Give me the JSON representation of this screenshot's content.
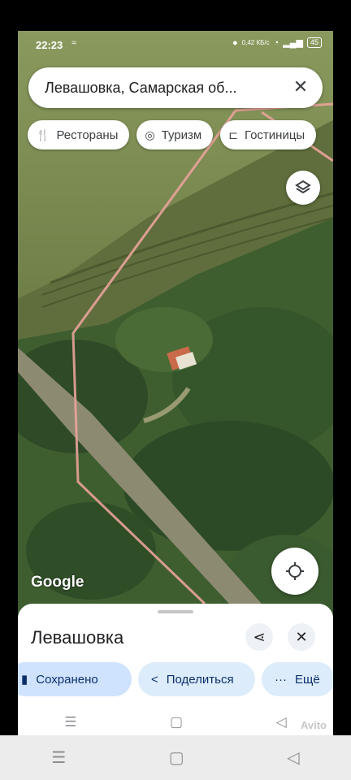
{
  "status_bar": {
    "time": "22:23",
    "network_speed": "0,42 КБ/с",
    "battery": "45"
  },
  "search": {
    "query": "Левашовка, Самарская об...",
    "close_icon": "close-icon"
  },
  "chips": [
    {
      "label": "Рестораны",
      "icon": "restaurant-icon"
    },
    {
      "label": "Туризм",
      "icon": "camera-icon"
    },
    {
      "label": "Гостиницы",
      "icon": "bed-icon"
    }
  ],
  "map": {
    "attribution": "Google"
  },
  "place_sheet": {
    "title": "Левашовка",
    "actions": [
      {
        "label": "Сохранено",
        "icon": "bookmark-icon"
      },
      {
        "label": "Поделиться",
        "icon": "share-icon"
      },
      {
        "label": "Ещё",
        "icon": "more-icon"
      }
    ],
    "watermark": "Avito"
  },
  "colors": {
    "boundary": "#e9a39a",
    "saved_chip": "#cfe3ff",
    "chip_bg": "#dcecfb"
  }
}
